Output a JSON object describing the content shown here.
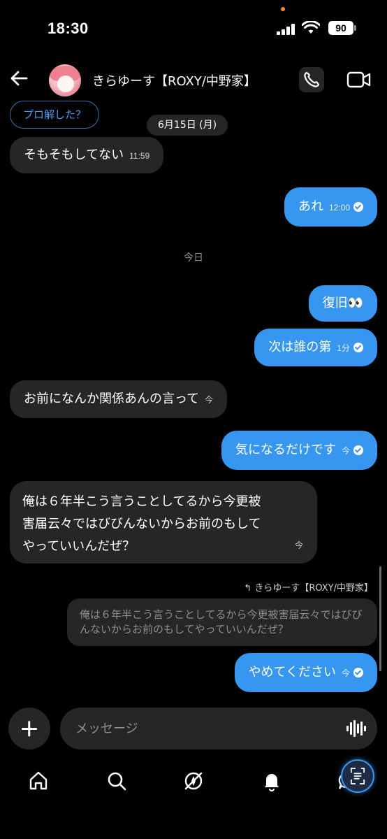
{
  "status_bar": {
    "time": "18:30",
    "battery": "90"
  },
  "header": {
    "name": "きらゆーす【ROXY/中野家】",
    "icons": [
      "back-arrow-icon",
      "phone-icon",
      "video-camera-icon"
    ]
  },
  "messages": {
    "pro_chip": "プロ解した？",
    "date_1": "6月15日 (月)",
    "in_1": {
      "text": "そもそもしてない",
      "time": "11:59"
    },
    "out_1": {
      "text": "あれ",
      "time": "12:00"
    },
    "date_today": "今日",
    "out_2": {
      "text": "復旧👀"
    },
    "out_3": {
      "text": "次は誰の第",
      "time": "1分"
    },
    "in_2": {
      "text": "お前になんか関係あんの言って",
      "time": "今"
    },
    "out_4": {
      "text": "気になるだけです",
      "time": "今"
    },
    "in_3": {
      "line1": "俺は６年半こう言うことしてるから今更被",
      "line2": "害届云々ではびびんないからお前のもして",
      "line3": "やっていいんだぜ？",
      "time": "今"
    },
    "reply_to": "きらゆーす【ROXY/中野家】",
    "reply_quote": "俺は６年半こう言うことしてるから今更被害届云々ではびびんないからお前のもしてやっていいんだぜ？",
    "out_5": {
      "text": "やめてください",
      "time": "今"
    }
  },
  "composer": {
    "placeholder": "メッセージ"
  },
  "colors": {
    "background": "#000000",
    "incoming_bubble": "#262626",
    "outgoing_bubble": "#3797f0",
    "muted_text": "#8e8e8e"
  },
  "bottom_nav": [
    "home-icon",
    "search-icon",
    "explore-icon",
    "notifications-icon",
    "chat-icon"
  ]
}
